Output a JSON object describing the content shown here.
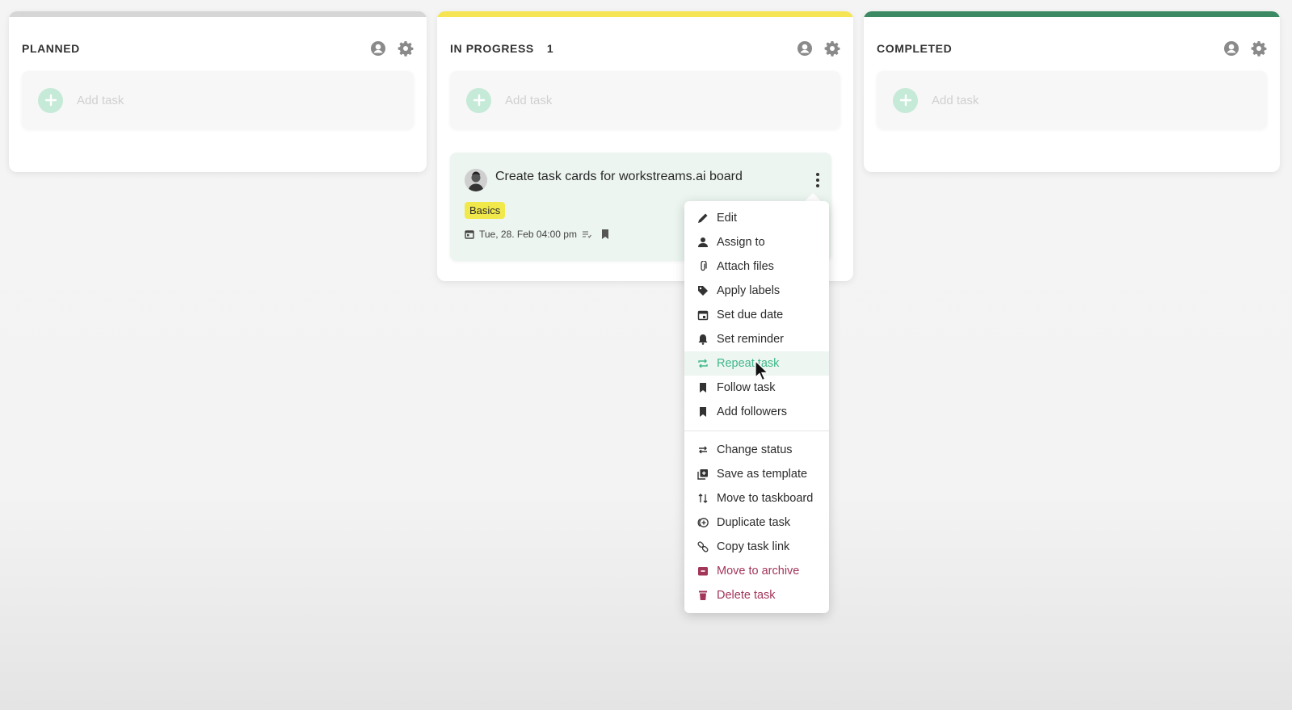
{
  "columns": [
    {
      "title": "PLANNED",
      "count": "",
      "bar_color": "#d6d6d6",
      "add_task": "Add task"
    },
    {
      "title": "IN PROGRESS",
      "count": "1",
      "bar_color": "#f5e453",
      "add_task": "Add task"
    },
    {
      "title": "COMPLETED",
      "count": "",
      "bar_color": "#3b8a63",
      "add_task": "Add task"
    }
  ],
  "column_icons": [
    "user-icon",
    "gear-icon"
  ],
  "task": {
    "title": "Create task cards for workstreams.ai board",
    "label": "Basics",
    "label_color": "#f1e94b",
    "due": "Tue, 28. Feb 04:00 pm"
  },
  "menu": {
    "group1": [
      {
        "label": "Edit",
        "icon": "pencil-icon"
      },
      {
        "label": "Assign to",
        "icon": "person-icon"
      },
      {
        "label": "Attach files",
        "icon": "paperclip-icon"
      },
      {
        "label": "Apply labels",
        "icon": "tag-icon"
      },
      {
        "label": "Set due date",
        "icon": "calendar-icon"
      },
      {
        "label": "Set reminder",
        "icon": "bell-icon"
      },
      {
        "label": "Repeat task",
        "icon": "repeat-icon",
        "state": "hovered"
      },
      {
        "label": "Follow task",
        "icon": "bookmark-icon"
      },
      {
        "label": "Add followers",
        "icon": "bookmark-icon"
      }
    ],
    "group2": [
      {
        "label": "Change status",
        "icon": "swap-icon"
      },
      {
        "label": "Save as template",
        "icon": "template-icon"
      },
      {
        "label": "Move to taskboard",
        "icon": "move-icon"
      },
      {
        "label": "Duplicate task",
        "icon": "duplicate-icon"
      },
      {
        "label": "Copy task link",
        "icon": "link-icon"
      },
      {
        "label": "Move to archive",
        "icon": "archive-icon",
        "variant": "danger"
      },
      {
        "label": "Delete task",
        "icon": "trash-icon",
        "variant": "danger"
      }
    ]
  },
  "colors": {
    "accent": "#3fb88a",
    "danger": "#a33559",
    "card_bg": "#ecf5ef"
  }
}
